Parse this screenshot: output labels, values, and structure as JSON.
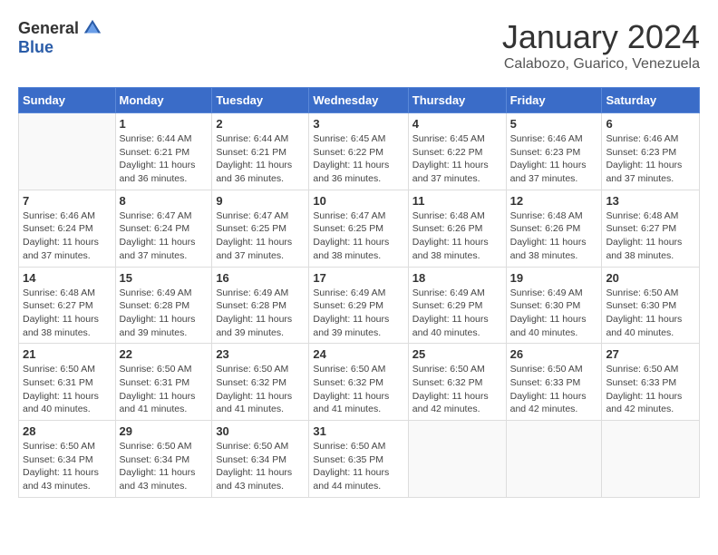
{
  "header": {
    "logo": {
      "general": "General",
      "blue": "Blue"
    },
    "title": "January 2024",
    "location": "Calabozo, Guarico, Venezuela"
  },
  "weekdays": [
    "Sunday",
    "Monday",
    "Tuesday",
    "Wednesday",
    "Thursday",
    "Friday",
    "Saturday"
  ],
  "weeks": [
    [
      {
        "day": "",
        "info": ""
      },
      {
        "day": "1",
        "info": "Sunrise: 6:44 AM\nSunset: 6:21 PM\nDaylight: 11 hours and 36 minutes."
      },
      {
        "day": "2",
        "info": "Sunrise: 6:44 AM\nSunset: 6:21 PM\nDaylight: 11 hours and 36 minutes."
      },
      {
        "day": "3",
        "info": "Sunrise: 6:45 AM\nSunset: 6:22 PM\nDaylight: 11 hours and 36 minutes."
      },
      {
        "day": "4",
        "info": "Sunrise: 6:45 AM\nSunset: 6:22 PM\nDaylight: 11 hours and 37 minutes."
      },
      {
        "day": "5",
        "info": "Sunrise: 6:46 AM\nSunset: 6:23 PM\nDaylight: 11 hours and 37 minutes."
      },
      {
        "day": "6",
        "info": "Sunrise: 6:46 AM\nSunset: 6:23 PM\nDaylight: 11 hours and 37 minutes."
      }
    ],
    [
      {
        "day": "7",
        "info": "Sunrise: 6:46 AM\nSunset: 6:24 PM\nDaylight: 11 hours and 37 minutes."
      },
      {
        "day": "8",
        "info": "Sunrise: 6:47 AM\nSunset: 6:24 PM\nDaylight: 11 hours and 37 minutes."
      },
      {
        "day": "9",
        "info": "Sunrise: 6:47 AM\nSunset: 6:25 PM\nDaylight: 11 hours and 37 minutes."
      },
      {
        "day": "10",
        "info": "Sunrise: 6:47 AM\nSunset: 6:25 PM\nDaylight: 11 hours and 38 minutes."
      },
      {
        "day": "11",
        "info": "Sunrise: 6:48 AM\nSunset: 6:26 PM\nDaylight: 11 hours and 38 minutes."
      },
      {
        "day": "12",
        "info": "Sunrise: 6:48 AM\nSunset: 6:26 PM\nDaylight: 11 hours and 38 minutes."
      },
      {
        "day": "13",
        "info": "Sunrise: 6:48 AM\nSunset: 6:27 PM\nDaylight: 11 hours and 38 minutes."
      }
    ],
    [
      {
        "day": "14",
        "info": "Sunrise: 6:48 AM\nSunset: 6:27 PM\nDaylight: 11 hours and 38 minutes."
      },
      {
        "day": "15",
        "info": "Sunrise: 6:49 AM\nSunset: 6:28 PM\nDaylight: 11 hours and 39 minutes."
      },
      {
        "day": "16",
        "info": "Sunrise: 6:49 AM\nSunset: 6:28 PM\nDaylight: 11 hours and 39 minutes."
      },
      {
        "day": "17",
        "info": "Sunrise: 6:49 AM\nSunset: 6:29 PM\nDaylight: 11 hours and 39 minutes."
      },
      {
        "day": "18",
        "info": "Sunrise: 6:49 AM\nSunset: 6:29 PM\nDaylight: 11 hours and 40 minutes."
      },
      {
        "day": "19",
        "info": "Sunrise: 6:49 AM\nSunset: 6:30 PM\nDaylight: 11 hours and 40 minutes."
      },
      {
        "day": "20",
        "info": "Sunrise: 6:50 AM\nSunset: 6:30 PM\nDaylight: 11 hours and 40 minutes."
      }
    ],
    [
      {
        "day": "21",
        "info": "Sunrise: 6:50 AM\nSunset: 6:31 PM\nDaylight: 11 hours and 40 minutes."
      },
      {
        "day": "22",
        "info": "Sunrise: 6:50 AM\nSunset: 6:31 PM\nDaylight: 11 hours and 41 minutes."
      },
      {
        "day": "23",
        "info": "Sunrise: 6:50 AM\nSunset: 6:32 PM\nDaylight: 11 hours and 41 minutes."
      },
      {
        "day": "24",
        "info": "Sunrise: 6:50 AM\nSunset: 6:32 PM\nDaylight: 11 hours and 41 minutes."
      },
      {
        "day": "25",
        "info": "Sunrise: 6:50 AM\nSunset: 6:32 PM\nDaylight: 11 hours and 42 minutes."
      },
      {
        "day": "26",
        "info": "Sunrise: 6:50 AM\nSunset: 6:33 PM\nDaylight: 11 hours and 42 minutes."
      },
      {
        "day": "27",
        "info": "Sunrise: 6:50 AM\nSunset: 6:33 PM\nDaylight: 11 hours and 42 minutes."
      }
    ],
    [
      {
        "day": "28",
        "info": "Sunrise: 6:50 AM\nSunset: 6:34 PM\nDaylight: 11 hours and 43 minutes."
      },
      {
        "day": "29",
        "info": "Sunrise: 6:50 AM\nSunset: 6:34 PM\nDaylight: 11 hours and 43 minutes."
      },
      {
        "day": "30",
        "info": "Sunrise: 6:50 AM\nSunset: 6:34 PM\nDaylight: 11 hours and 43 minutes."
      },
      {
        "day": "31",
        "info": "Sunrise: 6:50 AM\nSunset: 6:35 PM\nDaylight: 11 hours and 44 minutes."
      },
      {
        "day": "",
        "info": ""
      },
      {
        "day": "",
        "info": ""
      },
      {
        "day": "",
        "info": ""
      }
    ]
  ]
}
